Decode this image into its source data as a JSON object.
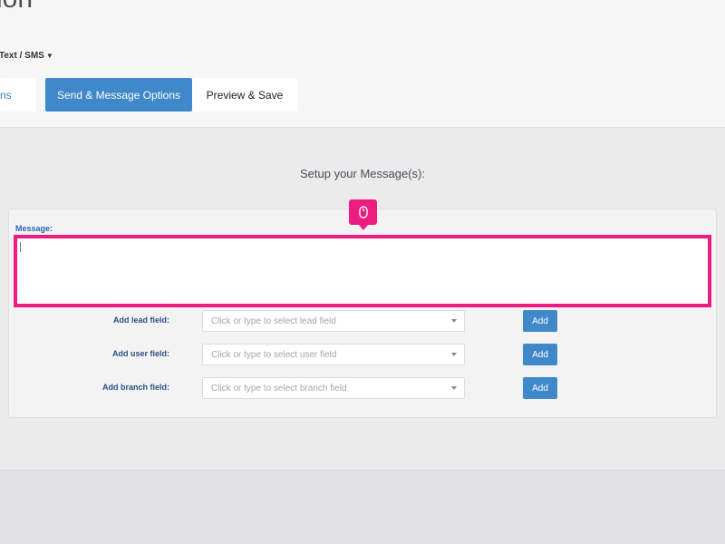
{
  "page": {
    "title": "ion"
  },
  "message_type": {
    "selected": "Text / SMS"
  },
  "steps": [
    {
      "label": "ns"
    },
    {
      "label": "Send & Message Options"
    },
    {
      "label": "Preview & Save"
    }
  ],
  "setup": {
    "title": "Setup your Message(s):"
  },
  "message": {
    "label": "Message:",
    "value": ""
  },
  "fields": [
    {
      "label": "Add lead field:",
      "placeholder": "Click or type to select lead field",
      "button": "Add"
    },
    {
      "label": "Add user field:",
      "placeholder": "Click or type to select user field",
      "button": "Add"
    },
    {
      "label": "Add branch field:",
      "placeholder": "Click or type to select branch field",
      "button": "Add"
    }
  ],
  "colors": {
    "accent": "#3f88c9",
    "highlight": "#ec1c80",
    "label": "#2b4f86"
  },
  "icons": {
    "click_marker": "mouse-icon",
    "dropdown": "chevron-down-icon"
  }
}
